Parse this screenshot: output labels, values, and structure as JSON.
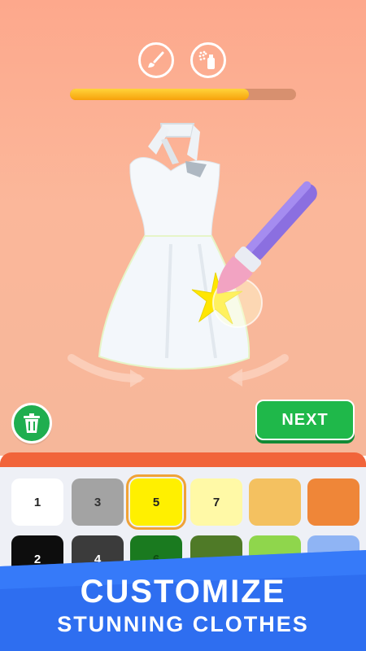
{
  "tools": [
    {
      "name": "paintbrush-icon"
    },
    {
      "name": "spray-can-icon"
    }
  ],
  "progress": 0.79,
  "next_label": "NEXT",
  "palette": [
    {
      "label": "1",
      "color": "#ffffff",
      "text_color": "#222222",
      "selected": false
    },
    {
      "label": "3",
      "color": "#a3a3a3",
      "text_color": "#333333",
      "selected": false
    },
    {
      "label": "5",
      "color": "#fff000",
      "text_color": "#222222",
      "selected": true
    },
    {
      "label": "7",
      "color": "#fff9a6",
      "text_color": "#222222",
      "selected": false
    },
    {
      "label": "",
      "color": "#f4c160",
      "text_color": "#222222",
      "selected": false
    },
    {
      "label": "",
      "color": "#ef8638",
      "text_color": "#222222",
      "selected": false
    },
    {
      "label": "2",
      "color": "#0d0d0d",
      "text_color": "#ffffff",
      "selected": false
    },
    {
      "label": "4",
      "color": "#3b3b3b",
      "text_color": "#ffffff",
      "selected": false
    },
    {
      "label": "6",
      "color": "#1a7a1f",
      "text_color": "#0d4d10",
      "selected": false
    },
    {
      "label": "",
      "color": "#4f7a27",
      "text_color": "#ffffff",
      "selected": false
    },
    {
      "label": "",
      "color": "#8fd64c",
      "text_color": "#ffffff",
      "selected": false
    },
    {
      "label": "",
      "color": "#8fb4f4",
      "text_color": "#ffffff",
      "selected": false
    }
  ],
  "banner": {
    "line1": "CUSTOMIZE",
    "line2": "STUNNING CLOTHES"
  }
}
